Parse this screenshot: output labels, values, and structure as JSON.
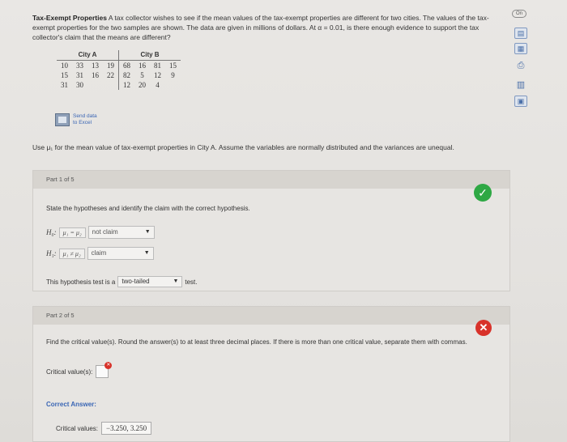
{
  "intro": {
    "title": "Tax-Exempt Properties",
    "text": " A tax collector wishes to see if the mean values of the tax-exempt properties are different for two cities. The values of the tax-exempt properties for the two samples are shown. The data are given in millions of dollars. At α = 0.01, is there enough evidence to support the tax collector's claim that the means are different?"
  },
  "table": {
    "city_a_header": "City A",
    "city_b_header": "City B",
    "rows": [
      [
        "10",
        "33",
        "13",
        "19",
        "68",
        "16",
        "81",
        "15"
      ],
      [
        "15",
        "31",
        "16",
        "22",
        "82",
        "5",
        "12",
        "9"
      ],
      [
        "31",
        "30",
        "",
        "",
        "12",
        "20",
        "4",
        ""
      ]
    ]
  },
  "send_data": {
    "line1": "Send data",
    "line2": "to Excel"
  },
  "use_text": "Use μ₁ for the mean value of tax-exempt properties in City A. Assume the variables are normally distributed and the variances are unequal.",
  "part1": {
    "label": "Part 1 of 5",
    "instruction": "State the hypotheses and identify the claim with the correct hypothesis.",
    "h0_label": "H₀:",
    "h0_expr": "μ₁ = μ₂",
    "h0_claim": "not claim",
    "h1_label": "H₁:",
    "h1_expr": "μ₁ ≠ μ₂",
    "h1_claim": "claim",
    "test_prefix": "This hypothesis test is a",
    "test_value": "two-tailed",
    "test_suffix": "test."
  },
  "part2": {
    "label": "Part 2 of 5",
    "instruction": "Find the critical value(s). Round the answer(s) to at least three decimal places. If there is more than one critical value, separate them with commas.",
    "critical_label": "Critical value(s):",
    "correct_label": "Correct Answer:",
    "correct_prefix": "Critical values:",
    "correct_value": "−3.250, 3.250"
  },
  "toolbar": {
    "badge": "On",
    "icons": [
      "data-icon",
      "calculator-icon",
      "print-icon",
      "stats-icon",
      "table-icon"
    ]
  }
}
